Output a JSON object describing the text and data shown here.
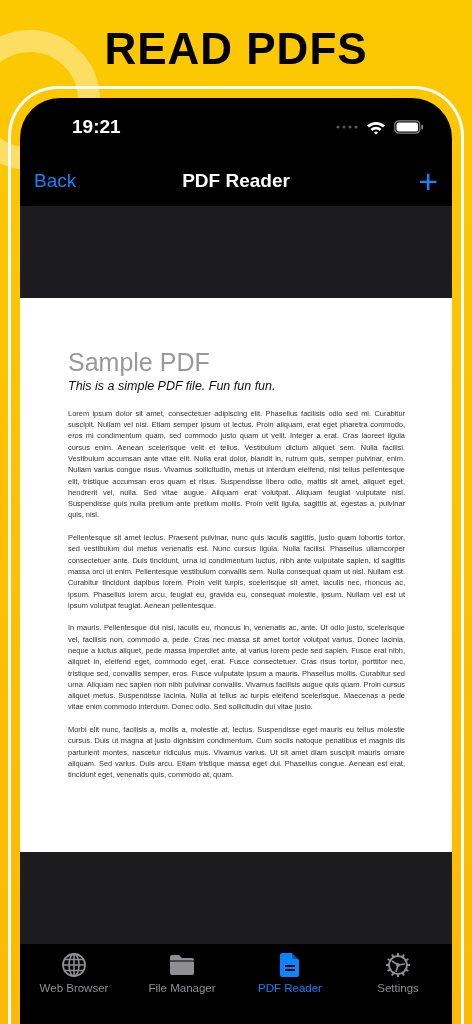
{
  "banner": {
    "title": "READ PDFS"
  },
  "status_bar": {
    "time": "19:21"
  },
  "nav_bar": {
    "back": "Back",
    "title": "PDF Reader",
    "add": "+"
  },
  "document": {
    "title": "Sample PDF",
    "subtitle": "This is a simple PDF file. Fun fun fun.",
    "paragraphs": [
      "Lorem ipsum dolor sit amet, consectetuer adipiscing elit. Phasellus facilisis odio sed mi. Curabitur suscipit. Nullam vel nisi. Etiam semper ipsum ut lectus. Proin aliquam, erat eget pharetra commodo, eros mi condimentum quam, sed commodo justo quam ut velit. Integer a erat. Cras laoreet ligula cursus enim. Aenean scelerisque velit et tellus. Vestibulum dictum aliquet sem. Nulla facilisi. Vestibulum accumsan ante vitae elit. Nulla erat dolor, blandit in, rutrum quis, semper pulvinar, enim. Nullam varius congue risus. Vivamus sollicitudin, metus ut interdum eleifend, nisi tellus pellentesque elit, tristique accumsan eros quam et risus. Suspendisse libero odio, mattis sit amet, aliquet eget, hendrerit vel, nulla. Sed vitae augue. Aliquam erat volutpat. Aliquam feugiat vulputate nisl. Suspendisse quis nulla pretium ante pretium mollis. Proin velit ligula, sagittis at, egestas a, pulvinar quis, nisl.",
      "Pellentesque sit amet lectus. Praesent pulvinar, nunc quis iaculis sagittis, justo quam lobortis tortor, sed vestibulum dui metus venenatis est. Nunc cursus ligula. Nulla facilisi. Phasellus ullamcorper consectetuer ante. Duis tincidunt, urna id condimentum luctus, nibh ante vulputate sapien, id sagittis massa orci ut enim. Pellentesque vestibulum convallis sem. Nulla consequat quam ut nisl. Nullam est. Curabitur tincidunt dapibus lorem. Proin velit turpis, scelerisque sit amet, iaculis nec, rhoncus ac, ipsum. Phasellus lorem arcu, feugiat eu, gravida eu, consequat molestie, ipsum. Nullam vel est ut ipsum volutpat feugiat. Aenean pellentesque.",
      "In mauris. Pellentesque dui nisi, iaculis eu, rhoncus in, venenatis ac, ante. Ut odio justo, scelerisque vel, facilisis non, commodo a, pede. Cras nec massa sit amet tortor volutpat varius. Donec lacinia, neque a luctus aliquet, pede massa imperdiet ante, at varius lorem pede sed sapien. Fusce erat nibh, aliquet in, eleifend eget, commodo eget, erat. Fusce consectetuer. Cras risus tortor, porttitor nec, tristique sed, convallis semper, eros. Fusce vulputate ipsum a mauris. Phasellus mollis. Curabitur sed urna. Aliquam nec sapien non nibh pulvinar convallis. Vivamus facilisis augue quis quam. Proin cursus aliquet metus. Suspendisse lacinia. Nulla at tellus ac turpis eleifend scelerisque. Maecenas a pede vitae enim commodo interdum. Donec odio. Sed sollicitudin dui vitae justo.",
      "Morbi elit nunc, facilisis a, mollis a, molestie at, lectus. Suspendisse eget mauris eu tellus molestie cursus. Duis ut magna at justo dignissim condimentum. Cum sociis natoque penatibus et magnis dis parturient montes, nascetur ridiculus mus. Vivamus varius. Ut sit amet diam suscipit mauris ornare aliquam. Sed varius. Duis arcu. Etiam tristique massa eget dui. Phasellus congue. Aenean est erat, tincidunt eget, venenatis quis, commodo at, quam."
    ]
  },
  "tab_bar": [
    {
      "kind": "globe",
      "label": "Web Browser",
      "selected": false
    },
    {
      "kind": "folder",
      "label": "File Manager",
      "selected": false
    },
    {
      "kind": "document",
      "label": "PDF Reader",
      "selected": true
    },
    {
      "kind": "gear",
      "label": "Settings",
      "selected": false
    }
  ]
}
